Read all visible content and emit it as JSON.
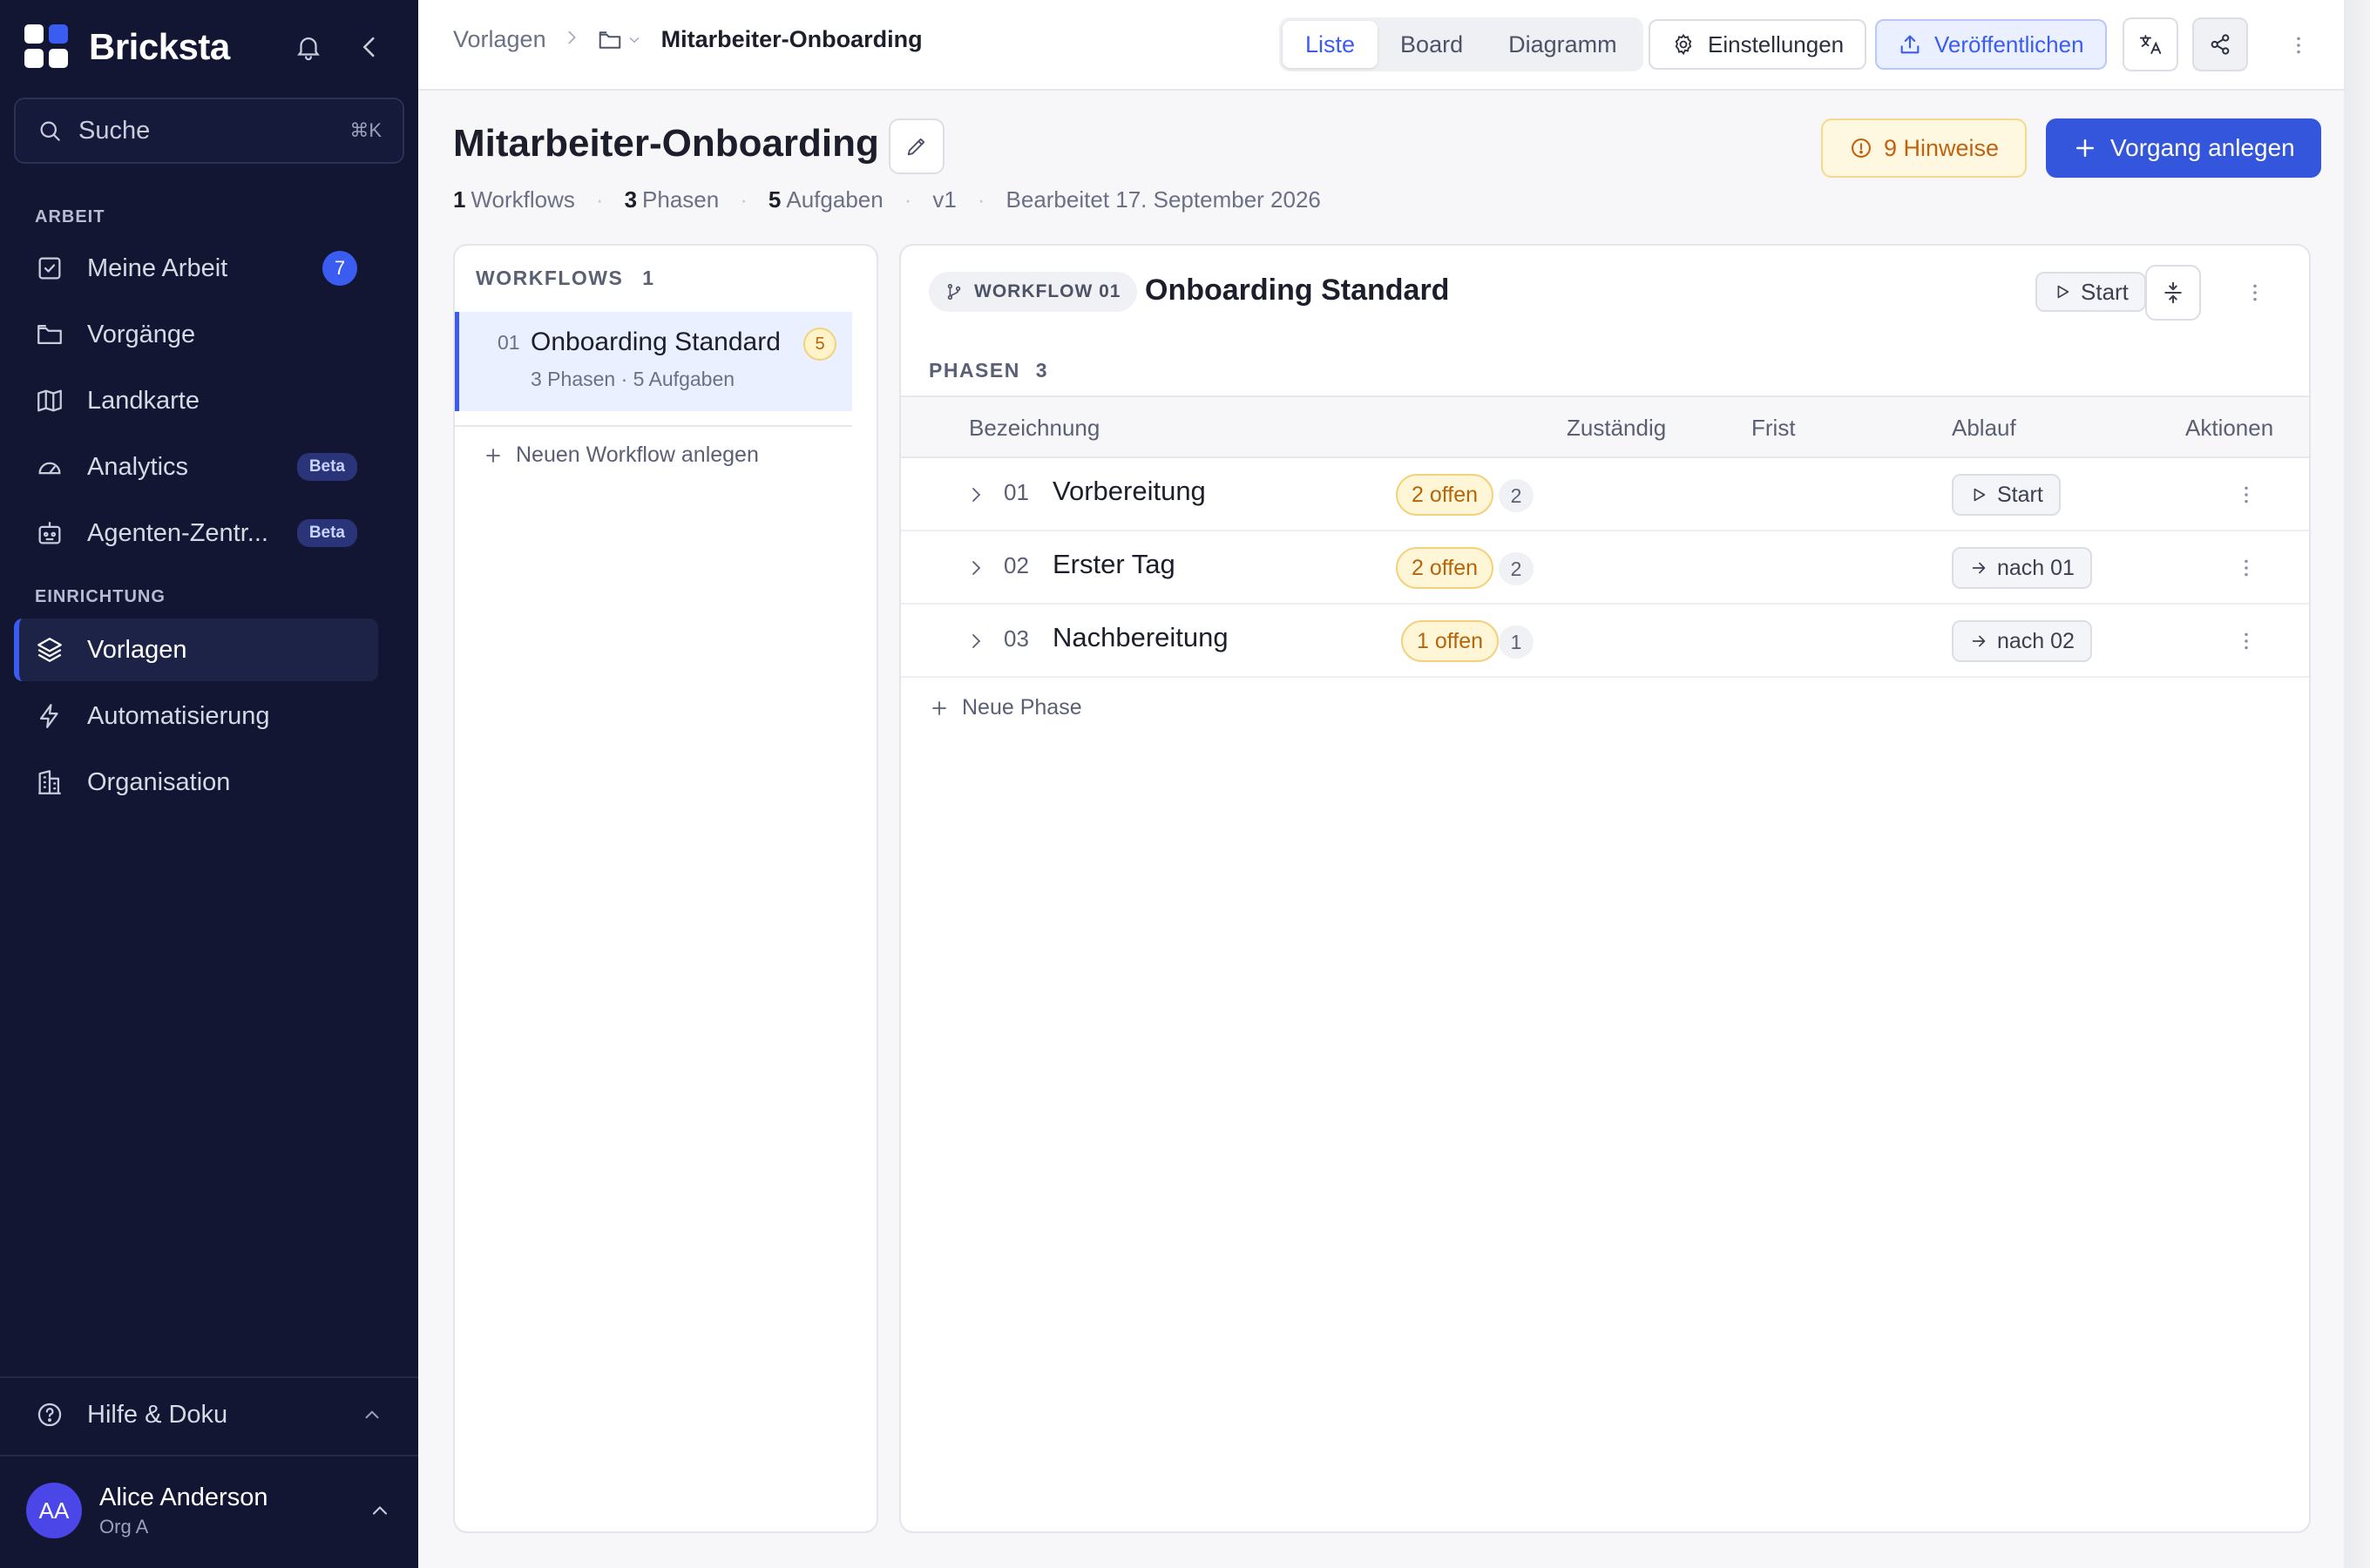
{
  "sidebar": {
    "brand": "Bricksta",
    "search": {
      "label": "Suche",
      "shortcut": "⌘K"
    },
    "sections": {
      "work": "ARBEIT",
      "setup": "EINRICHTUNG"
    },
    "items": [
      {
        "label": "Meine Arbeit",
        "icon": "checkbox-icon",
        "badge": "7"
      },
      {
        "label": "Vorgänge",
        "icon": "folder-icon"
      },
      {
        "label": "Landkarte",
        "icon": "map-icon"
      },
      {
        "label": "Analytics",
        "icon": "gauge-icon",
        "badge": "Beta"
      },
      {
        "label": "Agenten-Zentr...",
        "icon": "robot-icon",
        "badge": "Beta"
      },
      {
        "label": "Vorlagen",
        "icon": "layers-icon",
        "active": true
      },
      {
        "label": "Automatisierung",
        "icon": "bolt-icon"
      },
      {
        "label": "Organisation",
        "icon": "building-icon"
      }
    ],
    "help": "Hilfe & Doku",
    "user": {
      "initials": "AA",
      "name": "Alice Anderson",
      "org": "Org A"
    }
  },
  "topbar": {
    "breadcrumb": {
      "root": "Vorlagen",
      "current": "Mitarbeiter-Onboarding"
    },
    "views": [
      "Liste",
      "Board",
      "Diagramm"
    ],
    "active_view": "Liste",
    "settings": "Einstellungen",
    "publish": "Veröffentlichen"
  },
  "page": {
    "title": "Mitarbeiter-Onboarding",
    "meta": {
      "workflows_count": "1",
      "workflows_label": "Workflows",
      "phases_count": "3",
      "phases_label": "Phasen",
      "tasks_count": "5",
      "tasks_label": "Aufgaben",
      "version": "v1",
      "edited": "Bearbeitet 17. September 2026"
    },
    "hints": "9 Hinweise",
    "create": "Vorgang anlegen"
  },
  "workflows_panel": {
    "heading": "WORKFLOWS",
    "count": "1",
    "items": [
      {
        "num": "01",
        "name": "Onboarding Standard",
        "sub": "3 Phasen · 5 Aufgaben",
        "badge": "5"
      }
    ],
    "new": "Neuen Workflow anlegen"
  },
  "detail": {
    "tag": "WORKFLOW 01",
    "title": "Onboarding Standard",
    "start": "Start",
    "phases_heading": "PHASEN",
    "phases_count": "3",
    "columns": [
      "Bezeichnung",
      "Zuständig",
      "Frist",
      "Ablauf",
      "Aktionen"
    ],
    "rows": [
      {
        "num": "01",
        "name": "Vorbereitung",
        "open": "2 offen",
        "count": "2",
        "flow": "Start"
      },
      {
        "num": "02",
        "name": "Erster Tag",
        "open": "2 offen",
        "count": "2",
        "flow": "nach 01"
      },
      {
        "num": "03",
        "name": "Nachbereitung",
        "open": "1 offen",
        "count": "1",
        "flow": "nach 02"
      }
    ],
    "new_phase": "Neue Phase"
  },
  "colors": {
    "sidebar_bg": "#121633",
    "accent": "#3b5cf0",
    "warning": "#c2620e"
  }
}
